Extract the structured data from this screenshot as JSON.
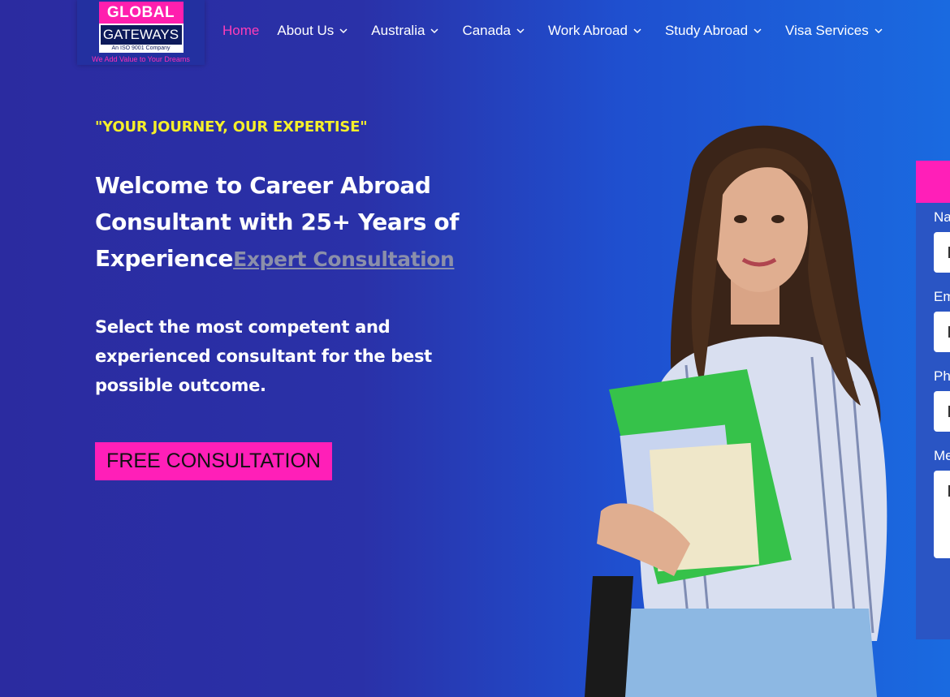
{
  "logo": {
    "line1": "GLOBAL",
    "line2": "GATEWAYS",
    "iso": "An ISO 9001 Company",
    "tagline": "We Add Value to Your Dreams"
  },
  "nav": {
    "items": [
      {
        "label": "Home",
        "active": true,
        "dropdown": false
      },
      {
        "label": "About Us",
        "active": false,
        "dropdown": true
      },
      {
        "label": "Australia",
        "active": false,
        "dropdown": true
      },
      {
        "label": "Canada",
        "active": false,
        "dropdown": true
      },
      {
        "label": "Work Abroad",
        "active": false,
        "dropdown": true
      },
      {
        "label": "Study Abroad",
        "active": false,
        "dropdown": true
      },
      {
        "label": "Visa Services",
        "active": false,
        "dropdown": true
      }
    ]
  },
  "hero": {
    "tagline": "\"YOUR JOURNEY, OUR EXPERTISE\"",
    "headline_line1": "Welcome to Career Abroad",
    "headline_line2": "Consultant with 25+ Years of",
    "headline_line3": "Experience",
    "headline_link": "Expert Consultation",
    "subtext": "Select the most competent and experienced consultant for the best possible outcome.",
    "cta_label": "FREE CONSULTATION"
  },
  "form": {
    "labels": [
      "Na",
      "Em",
      "Ph",
      "Me"
    ]
  },
  "colors": {
    "accent_pink": "#ff1fb8",
    "tagline_yellow": "#f5ef2a",
    "background_start": "#2b2ba0",
    "background_end": "#1a6ae0"
  }
}
